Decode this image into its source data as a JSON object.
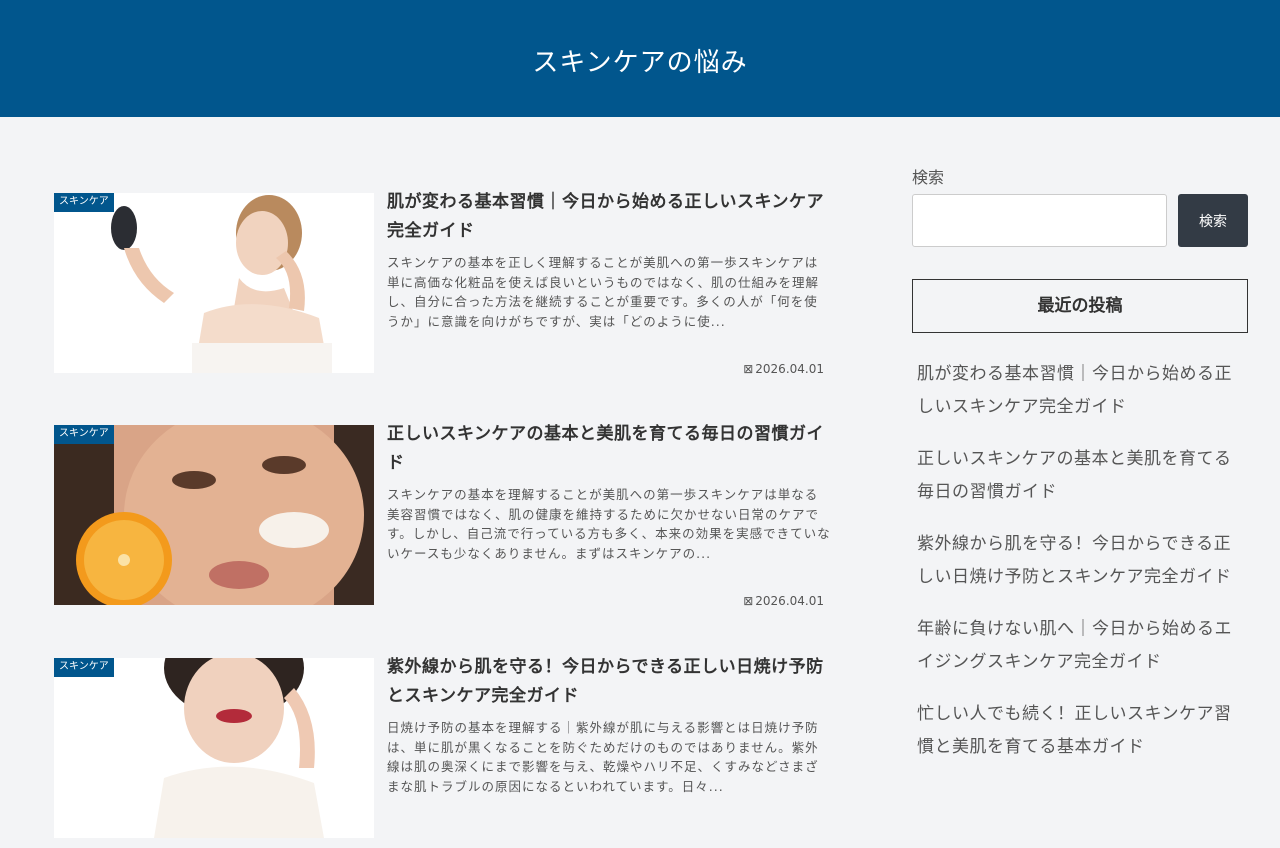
{
  "site": {
    "title": "スキンケアの悩み"
  },
  "posts": [
    {
      "category": "スキンケア",
      "title": "肌が変わる基本習慣｜今日から始める正しいスキンケア完全ガイド",
      "excerpt": "スキンケアの基本を正しく理解することが美肌への第一歩スキンケアは単に高価な化粧品を使えば良いというものではなく、肌の仕組みを理解し、自分に合った方法を継続することが重要です。多くの人が「何を使うか」に意識を向けがちですが、実は「どのように使...",
      "date": "2026.04.01"
    },
    {
      "category": "スキンケア",
      "title": "正しいスキンケアの基本と美肌を育てる毎日の習慣ガイド",
      "excerpt": "スキンケアの基本を理解することが美肌への第一歩スキンケアは単なる美容習慣ではなく、肌の健康を維持するために欠かせない日常のケアです。しかし、自己流で行っている方も多く、本来の効果を実感できていないケースも少なくありません。まずはスキンケアの...",
      "date": "2026.04.01"
    },
    {
      "category": "スキンケア",
      "title": "紫外線から肌を守る！今日からできる正しい日焼け予防とスキンケア完全ガイド",
      "excerpt": "日焼け予防の基本を理解する｜紫外線が肌に与える影響とは日焼け予防は、単に肌が黒くなることを防ぐためだけのものではありません。紫外線は肌の奥深くにまで影響を与え、乾燥やハリ不足、くすみなどさまざまな肌トラブルの原因になるといわれています。日々...",
      "date": ""
    }
  ],
  "sidebar": {
    "search_label": "検索",
    "search_placeholder": "",
    "search_button": "検索",
    "recent_title": "最近の投稿",
    "recent_posts": [
      "肌が変わる基本習慣｜今日から始める正しいスキンケア完全ガイド",
      "正しいスキンケアの基本と美肌を育てる毎日の習慣ガイド",
      "紫外線から肌を守る！今日からできる正しい日焼け予防とスキンケア完全ガイド",
      "年齢に負けない肌へ｜今日から始めるエイジングスキンケア完全ガイド",
      "忙しい人でも続く！正しいスキンケア習慣と美肌を育てる基本ガイド"
    ]
  },
  "icons": {
    "date": "clock-icon"
  },
  "colors": {
    "header_bg": "#01568d",
    "badge_bg": "#01568d",
    "page_bg": "#f3f4f6",
    "button_bg": "#333b45"
  }
}
